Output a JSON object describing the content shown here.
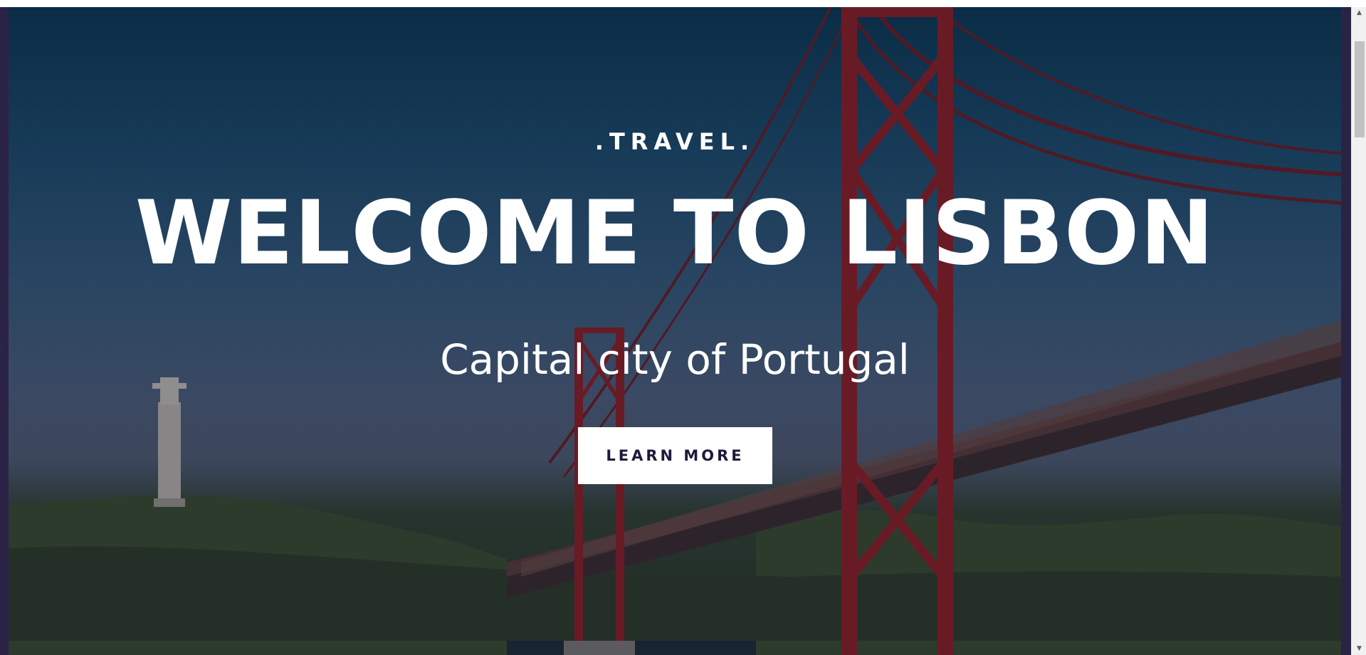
{
  "hero": {
    "kicker": ".TRAVEL.",
    "title": "WELCOME TO LISBON",
    "subtitle": "Capital city of Portugal",
    "cta_label": "LEARN MORE"
  },
  "background": {
    "description_icon": "lisbon-bridge-photo"
  },
  "colors": {
    "frame": "#2a2346",
    "button_text": "#1f1a3d",
    "bridge_red": "#8e1e22"
  },
  "scrollbar": {
    "up_icon": "▲",
    "down_icon": "▼"
  }
}
